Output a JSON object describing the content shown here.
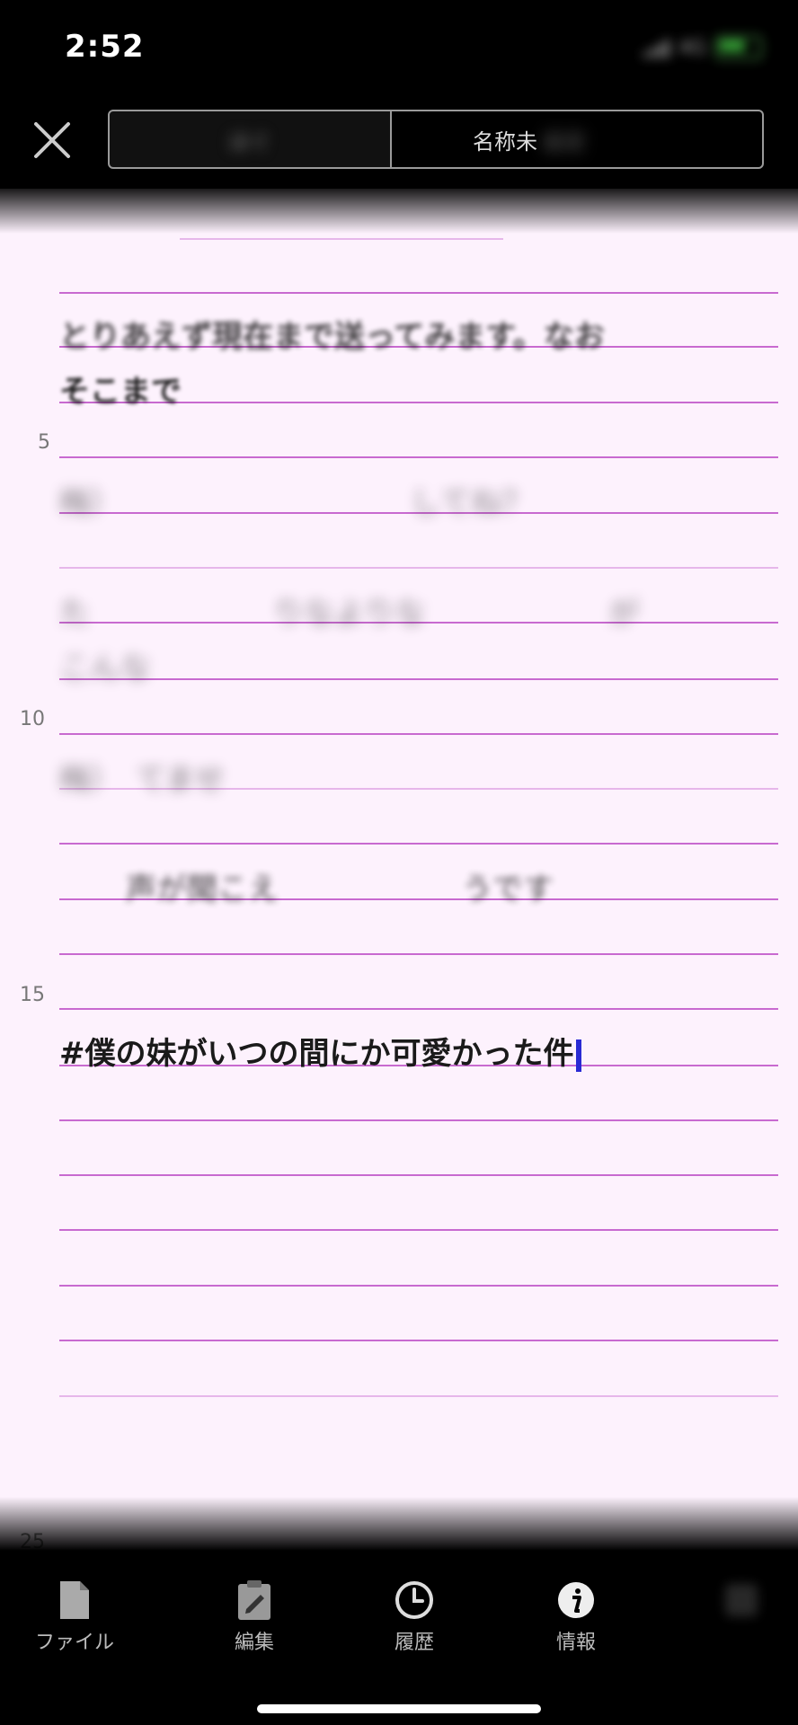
{
  "status": {
    "time": "2:52",
    "network": "4G"
  },
  "nav": {
    "tab_left": "ほぐ",
    "tab_right": "名称未",
    "tab_right_tail": "設定"
  },
  "editor": {
    "line_numbers": [
      "5",
      "10",
      "15",
      "25"
    ],
    "lines": [
      {
        "text": "とりあえず現在まで送ってみます。なお",
        "style": "mix"
      },
      {
        "text": "そこまで",
        "style": "mix"
      },
      {
        "text": "梅）　　　　　　　　　　してね？",
        "style": "blur"
      },
      {
        "text": "た　　　　　　りなよりな　　　　　　が",
        "style": "blur"
      },
      {
        "text": "こんな",
        "style": "blur"
      },
      {
        "text": "梅）　てませ",
        "style": "blur"
      },
      {
        "text": "声が聞こえ　　　　　　うです",
        "style": "blur"
      },
      {
        "text": "#僕の妹がいつの間にか可愛かった件",
        "style": "bold"
      }
    ]
  },
  "tabbar": {
    "items": [
      {
        "label": "ファイル",
        "icon": "file-icon"
      },
      {
        "label": "編集",
        "icon": "clipboard-edit-icon"
      },
      {
        "label": "履歴",
        "icon": "clock-icon"
      },
      {
        "label": "情報",
        "icon": "info-icon"
      },
      {
        "label": "",
        "icon": "more-icon"
      }
    ]
  },
  "colors": {
    "paper": "#fdf2fd",
    "rule": "#c86ad0",
    "caret": "#2a2ad4"
  }
}
